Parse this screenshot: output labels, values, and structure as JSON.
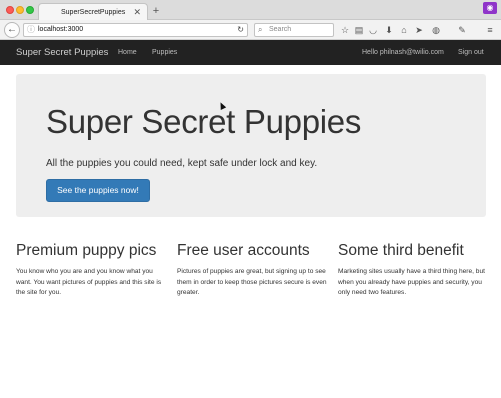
{
  "browser": {
    "tab_title": "SuperSecretPuppies",
    "tab_close": "✕",
    "new_tab": "+",
    "url": "localhost:3000",
    "search_placeholder": "Search"
  },
  "navbar": {
    "brand": "Super Secret Puppies",
    "links": [
      "Home",
      "Puppies"
    ],
    "user_text": "Hello philnash@twilio.com",
    "sign_out": "Sign out"
  },
  "jumbotron": {
    "title": "Super Secret Puppies",
    "lead": "All the puppies you could need, kept safe under lock and key.",
    "button": "See the puppies now!"
  },
  "features": [
    {
      "title": "Premium puppy pics",
      "text": "You know who you are and you know what you want. You want pictures of puppies and this site is the site for you."
    },
    {
      "title": "Free user accounts",
      "text": "Pictures of puppies are great, but signing up to see them in order to keep those pictures secure is even greater."
    },
    {
      "title": "Some third benefit",
      "text": "Marketing sites usually have a third thing here, but when you already have puppies and security, you only need two features."
    }
  ],
  "colors": {
    "navbar_bg": "#222222",
    "jumbotron_bg": "#eeeeee",
    "primary": "#337ab7",
    "extension_badge": "#8f34c9"
  }
}
